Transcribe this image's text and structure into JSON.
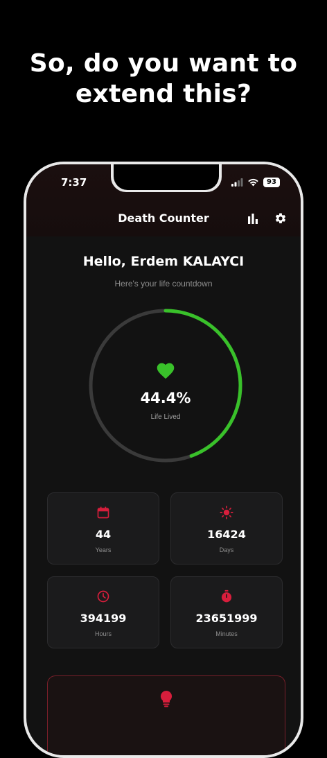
{
  "promo": {
    "headline_line1": "So, do you want to",
    "headline_line2": "extend this?"
  },
  "status_bar": {
    "time": "7:37",
    "battery": "93",
    "icons": [
      "signal-icon",
      "wifi-icon",
      "battery-icon"
    ]
  },
  "app_bar": {
    "title": "Death Counter",
    "actions": [
      "bar-chart-icon",
      "gear-icon"
    ]
  },
  "greeting": {
    "title": "Hello, Erdem KALAYCI",
    "subtitle": "Here's your life countdown"
  },
  "progress": {
    "value": 44.4,
    "display": "44.4%",
    "label": "Life Lived",
    "icon": "heart-icon",
    "accent_color": "#39c12a",
    "track_color": "#3a3a3a"
  },
  "stats": [
    {
      "icon": "calendar-icon",
      "value": "44",
      "label": "Years"
    },
    {
      "icon": "sun-icon",
      "value": "16424",
      "label": "Days"
    },
    {
      "icon": "clock-icon",
      "value": "394199",
      "label": "Hours"
    },
    {
      "icon": "stopwatch-icon",
      "value": "23651999",
      "label": "Minutes"
    }
  ],
  "tip_card": {
    "icon": "lightbulb-icon"
  },
  "colors": {
    "accent_red": "#d81e3c",
    "background": "#121212",
    "card": "#1b1b1c"
  }
}
